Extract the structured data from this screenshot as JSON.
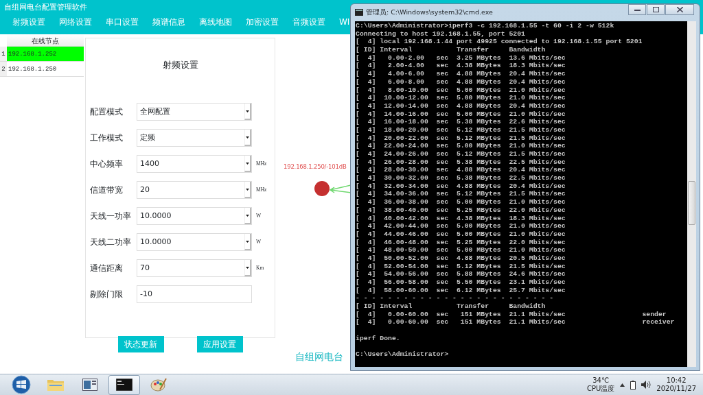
{
  "app": {
    "title": "自组网电台配置管理软件",
    "menu": [
      "射频设置",
      "网络设置",
      "串口设置",
      "频谱信息",
      "离线地图",
      "加密设置",
      "音频设置",
      "WI"
    ]
  },
  "node_table": {
    "column": "在线节点",
    "rows": [
      {
        "index": "1",
        "address": "192.168.1.252",
        "selected": true
      },
      {
        "index": "2",
        "address": "192.168.1.250",
        "selected": false
      }
    ]
  },
  "rf_panel": {
    "title": "射频设置",
    "fields": [
      {
        "label": "配置模式",
        "kind": "select",
        "value": "全网配置"
      },
      {
        "label": "工作模式",
        "kind": "select",
        "value": "定频"
      },
      {
        "label": "中心频率",
        "kind": "select",
        "value": "1400",
        "unit": "MHz"
      },
      {
        "label": "信道带宽",
        "kind": "select",
        "value": "20",
        "unit": "MHz"
      },
      {
        "label": "天线一功率",
        "kind": "select",
        "value": "10.0000",
        "unit": "W"
      },
      {
        "label": "天线二功率",
        "kind": "select",
        "value": "10.0000",
        "unit": "W"
      },
      {
        "label": "通信距离",
        "kind": "select",
        "value": "70",
        "unit": "Km"
      },
      {
        "label": "剔除门限",
        "kind": "text",
        "value": "-10"
      }
    ],
    "buttons": [
      "状态更新",
      "应用设置"
    ]
  },
  "map": {
    "node_label": "192.168.1.250/-101dB"
  },
  "footer_text": "自组网电台",
  "console": {
    "title": "管理员: C:\\Windows\\system32\\cmd.exe",
    "lines": [
      {
        "text": "C:\\Users\\Administrator>iperf3 -c 192.168.1.55 -t 60 -i 2 -w 512k"
      },
      {
        "text": "Connecting to host 192.168.1.55, port 5201"
      },
      {
        "text": "[  4] local 192.168.1.44 port 49925 connected to 192.168.1.55 port 5201"
      },
      {
        "text": "[ ID] Interval           Transfer     Bandwidth"
      },
      {
        "text": "[  4]   0.00-2.00   sec  3.25 MBytes  13.6 Mbits/sec"
      },
      {
        "text": "[  4]   2.00-4.00   sec  4.38 MBytes  18.3 Mbits/sec"
      },
      {
        "text": "[  4]   4.00-6.00   sec  4.88 MBytes  20.4 Mbits/sec"
      },
      {
        "text": "[  4]   6.00-8.00   sec  4.88 MBytes  20.4 Mbits/sec"
      },
      {
        "text": "[  4]   8.00-10.00  sec  5.00 MBytes  21.0 Mbits/sec"
      },
      {
        "text": "[  4]  10.00-12.00  sec  5.00 MBytes  21.0 Mbits/sec"
      },
      {
        "text": "[  4]  12.00-14.00  sec  4.88 MBytes  20.4 Mbits/sec"
      },
      {
        "text": "[  4]  14.00-16.00  sec  5.00 MBytes  21.0 Mbits/sec"
      },
      {
        "text": "[  4]  16.00-18.00  sec  5.38 MBytes  22.6 Mbits/sec"
      },
      {
        "text": "[  4]  18.00-20.00  sec  5.12 MBytes  21.5 Mbits/sec"
      },
      {
        "text": "[  4]  20.00-22.00  sec  5.12 MBytes  21.5 Mbits/sec"
      },
      {
        "text": "[  4]  22.00-24.00  sec  5.00 MBytes  21.0 Mbits/sec"
      },
      {
        "text": "[  4]  24.00-26.00  sec  5.12 MBytes  21.5 Mbits/sec"
      },
      {
        "text": "[  4]  26.00-28.00  sec  5.38 MBytes  22.5 Mbits/sec"
      },
      {
        "text": "[  4]  28.00-30.00  sec  4.88 MBytes  20.4 Mbits/sec"
      },
      {
        "text": "[  4]  30.00-32.00  sec  5.38 MBytes  22.5 Mbits/sec"
      },
      {
        "text": "[  4]  32.00-34.00  sec  4.88 MBytes  20.4 Mbits/sec"
      },
      {
        "text": "[  4]  34.00-36.00  sec  5.12 MBytes  21.5 Mbits/sec"
      },
      {
        "text": "[  4]  36.00-38.00  sec  5.00 MBytes  21.0 Mbits/sec"
      },
      {
        "text": "[  4]  38.00-40.00  sec  5.25 MBytes  22.0 Mbits/sec"
      },
      {
        "text": "[  4]  40.00-42.00  sec  4.38 MBytes  18.3 Mbits/sec"
      },
      {
        "text": "[  4]  42.00-44.00  sec  5.00 MBytes  21.0 Mbits/sec"
      },
      {
        "text": "[  4]  44.00-46.00  sec  5.00 MBytes  21.0 Mbits/sec"
      },
      {
        "text": "[  4]  46.00-48.00  sec  5.25 MBytes  22.0 Mbits/sec"
      },
      {
        "text": "[  4]  48.00-50.00  sec  5.00 MBytes  21.0 Mbits/sec"
      },
      {
        "text": "[  4]  50.00-52.00  sec  4.88 MBytes  20.5 Mbits/sec"
      },
      {
        "text": "[  4]  52.00-54.00  sec  5.12 MBytes  21.5 Mbits/sec"
      },
      {
        "text": "[  4]  54.00-56.00  sec  5.88 MBytes  24.6 Mbits/sec"
      },
      {
        "text": "[  4]  56.00-58.00  sec  5.50 MBytes  23.1 Mbits/sec"
      },
      {
        "text": "[  4]  58.00-60.00  sec  6.12 MBytes  25.7 Mbits/sec"
      },
      {
        "text": "- - - - - - - - - - - - - - - - - - - - - - - - -"
      },
      {
        "text": "[ ID] Interval           Transfer     Bandwidth"
      },
      {
        "text": "[  4]   0.00-60.00  sec   151 MBytes  21.1 Mbits/sec                   sender"
      },
      {
        "text": "[  4]   0.00-60.00  sec   151 MBytes  21.1 Mbits/sec                   receiver"
      },
      {
        "text": "iperf Done.",
        "gap_before": true
      },
      {
        "text": "C:\\Users\\Administrator>",
        "gap_before": true
      }
    ]
  },
  "taskbar": {
    "apps": [
      {
        "kind": "folder",
        "selected": false
      },
      {
        "kind": "window",
        "selected": false
      },
      {
        "kind": "console",
        "selected": true
      },
      {
        "kind": "paint",
        "selected": false
      }
    ],
    "temperature": "34℃",
    "temperature_label": "CPU温度",
    "time": "10:42",
    "date": "2020/11/27"
  }
}
